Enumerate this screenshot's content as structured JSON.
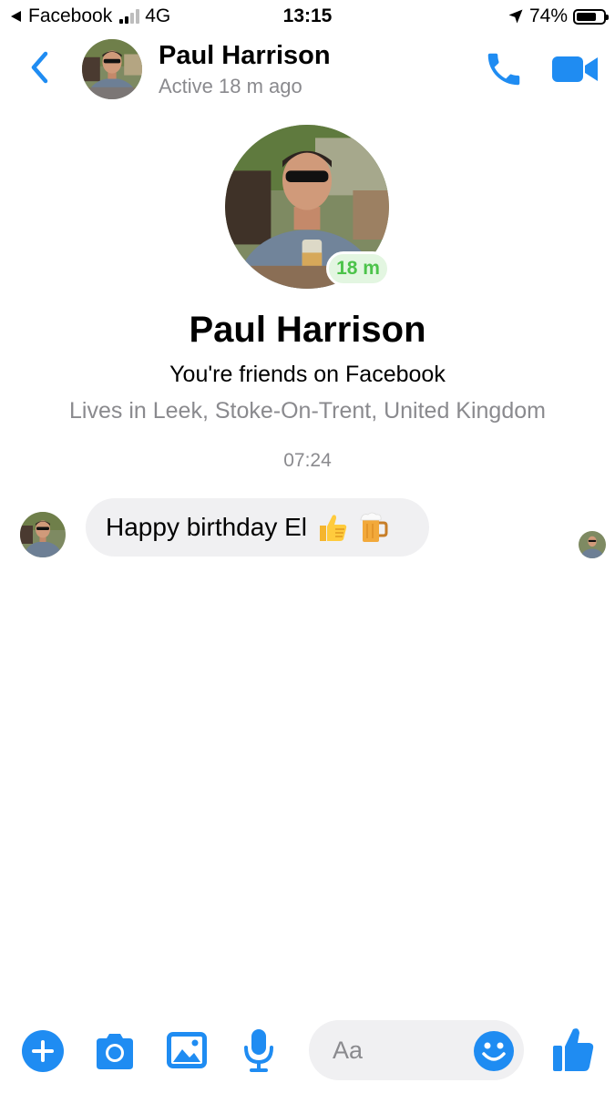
{
  "status_bar": {
    "back_app": "Facebook",
    "network": "4G",
    "time": "13:15",
    "battery": "74%",
    "battery_level": 0.74
  },
  "header": {
    "contact_name": "Paul Harrison",
    "active_status": "Active 18 m ago"
  },
  "profile": {
    "name": "Paul Harrison",
    "active_badge": "18 m",
    "friends_text": "You're friends on Facebook",
    "location": "Lives in Leek, Stoke-On-Trent, United Kingdom"
  },
  "conversation": {
    "timestamp": "07:24",
    "messages": [
      {
        "sender": "Paul Harrison",
        "text": "Happy birthday El",
        "emojis": [
          "thumbs-up",
          "beer-mug"
        ]
      }
    ]
  },
  "composer": {
    "placeholder": "Aa"
  },
  "colors": {
    "accent": "#1f8cf2",
    "active_green": "#4cc34a",
    "bubble": "#f0f0f2",
    "secondary_text": "#8a8a8e"
  },
  "icons": [
    "back-chevron-icon",
    "phone-icon",
    "video-camera-icon",
    "plus-icon",
    "camera-icon",
    "image-icon",
    "microphone-icon",
    "smiley-icon",
    "thumbs-up-icon",
    "location-arrow-icon",
    "beer-mug-icon"
  ]
}
